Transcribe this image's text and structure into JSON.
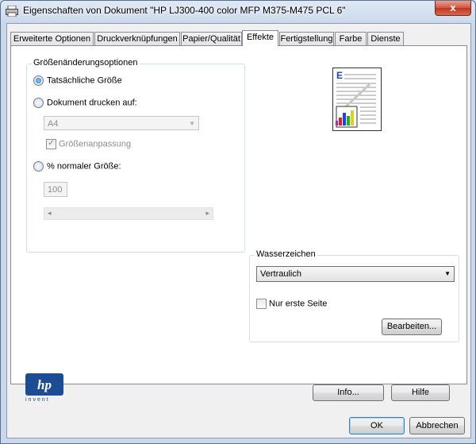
{
  "window": {
    "title": "Eigenschaften von Dokument \"HP LJ300-400 color MFP M375-M475 PCL 6\"",
    "close_label": "x"
  },
  "tabs": [
    {
      "label": "Erweiterte Optionen"
    },
    {
      "label": "Druckverknüpfungen"
    },
    {
      "label": "Papier/Qualität"
    },
    {
      "label": "Effekte"
    },
    {
      "label": "Fertigstellung"
    },
    {
      "label": "Farbe"
    },
    {
      "label": "Dienste"
    }
  ],
  "active_tab": "Effekte",
  "resize_options": {
    "title": "Größenänderungsoptionen",
    "actual_size_label": "Tatsächliche Größe",
    "print_document_on_label": "Dokument drucken auf:",
    "paper_size_value": "A4",
    "fit_to_size_label": "Größenanpassung",
    "percent_label": "% normaler Größe:",
    "percent_value": "100",
    "selected": "actual_size"
  },
  "watermark": {
    "title": "Wasserzeichen",
    "value": "Vertraulich",
    "first_page_only_label": "Nur erste Seite",
    "edit_button": "Bearbeiten..."
  },
  "logo": {
    "text": "invent"
  },
  "buttons": {
    "info": "Info...",
    "help": "Hilfe",
    "ok": "OK",
    "cancel": "Abbrechen"
  },
  "colors": {
    "accent": "#1c6ec7",
    "hp_blue": "#1b4c94"
  }
}
